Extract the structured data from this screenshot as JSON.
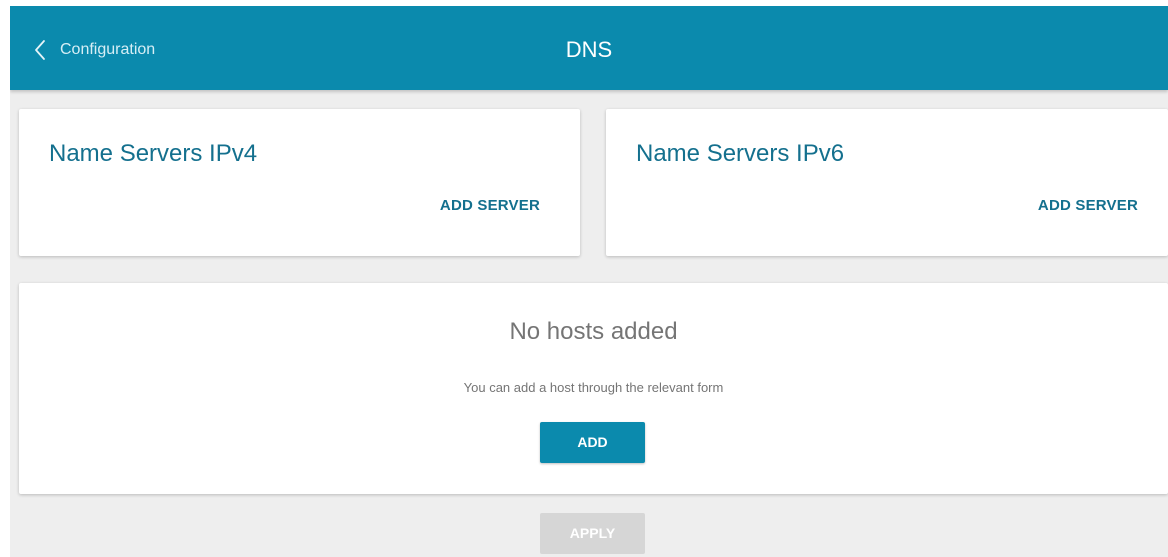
{
  "header": {
    "back_label": "Configuration",
    "title": "DNS",
    "background_color": "#0b8aad"
  },
  "name_servers": [
    {
      "title": "Name Servers IPv4",
      "add_label": "ADD SERVER"
    },
    {
      "title": "Name Servers IPv6",
      "add_label": "ADD SERVER"
    }
  ],
  "hosts": {
    "empty_title": "No hosts added",
    "empty_text": "You can add a host through the relevant form",
    "add_label": "ADD"
  },
  "footer": {
    "apply_label": "APPLY",
    "apply_enabled": false
  },
  "colors": {
    "accent": "#0b8aad",
    "text_primary": "#14708e",
    "text_muted": "#757575",
    "disabled": "#d6d6d6"
  },
  "icons": {
    "back": "chevron-left-icon"
  }
}
